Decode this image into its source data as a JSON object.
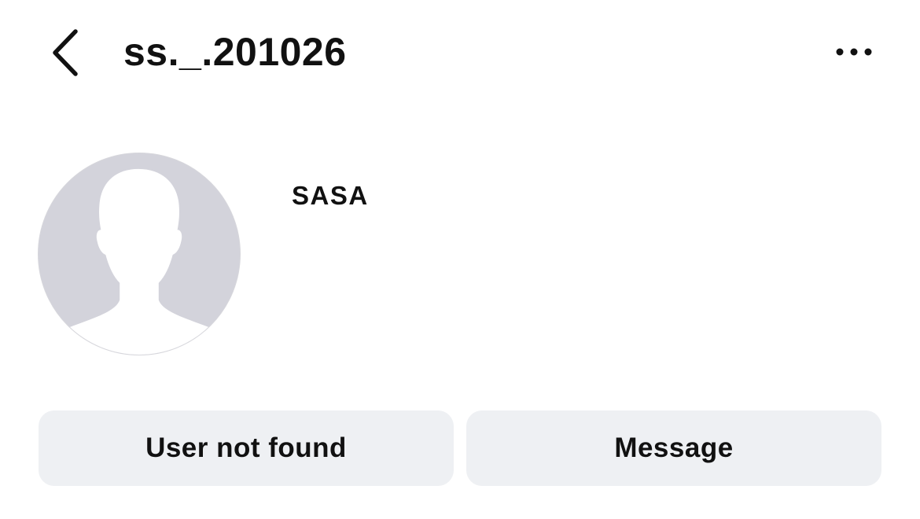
{
  "header": {
    "back_icon": "chevron-left-icon",
    "username": "ss._.201026",
    "more_icon": "more-horizontal-icon"
  },
  "profile": {
    "avatar_icon": "default-avatar-silhouette",
    "display_name": "SASA"
  },
  "actions": {
    "status_label": "User not found",
    "message_label": "Message"
  },
  "colors": {
    "background": "#ffffff",
    "button_background": "#eef0f3",
    "avatar_background": "#d3d3db",
    "text": "#111111"
  }
}
